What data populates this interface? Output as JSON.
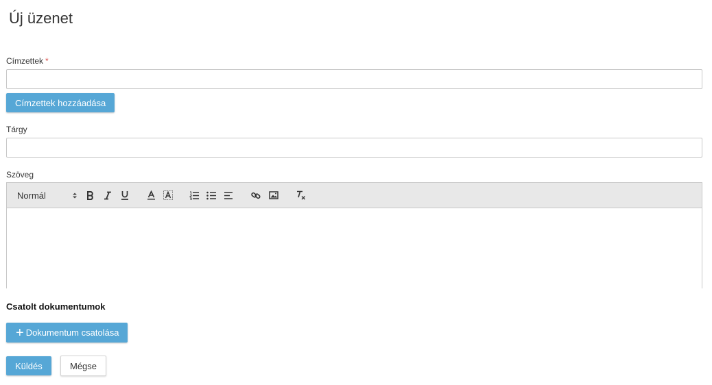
{
  "page": {
    "title": "Új üzenet"
  },
  "recipients": {
    "label": "Címzettek",
    "required_mark": "*",
    "value": "",
    "placeholder": "",
    "add_button_label": "Címzettek hozzáadása"
  },
  "subject": {
    "label": "Tárgy",
    "value": "",
    "placeholder": ""
  },
  "body": {
    "label": "Szöveg",
    "toolbar": {
      "format_select": "Normál",
      "icons": [
        "format-select-arrows-icon",
        "bold-icon",
        "italic-icon",
        "underline-icon",
        "text-color-icon",
        "background-color-icon",
        "ordered-list-icon",
        "bullet-list-icon",
        "align-icon",
        "link-icon",
        "image-icon",
        "clear-format-icon"
      ]
    },
    "content": ""
  },
  "attachments": {
    "heading": "Csatolt dokumentumok",
    "attach_button_label": "Dokumentum csatolása",
    "attach_icon": "+"
  },
  "actions": {
    "send_label": "Küldés",
    "cancel_label": "Mégse"
  },
  "colors": {
    "primary": "#56a7d6",
    "required": "#d9534f",
    "toolbar_bg": "#e8e8e8",
    "border": "#c8c8c8"
  }
}
